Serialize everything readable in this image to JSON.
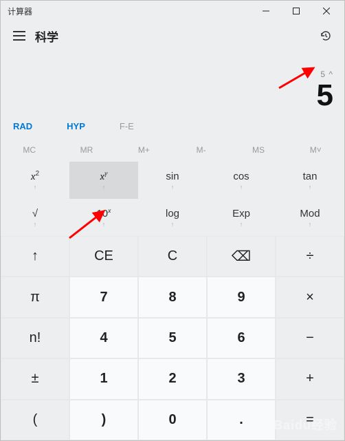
{
  "window_title": "计算器",
  "mode_title": "科学",
  "display": {
    "expr": "5 ^",
    "result": "5"
  },
  "mode_buttons": {
    "rad": "RAD",
    "hyp": "HYP",
    "fe": "F-E"
  },
  "memory": {
    "mc": "MC",
    "mr": "MR",
    "mplus": "M+",
    "mminus": "M-",
    "ms": "MS",
    "mlist": "M˅"
  },
  "func": {
    "r1": [
      {
        "main_html": "<span class='ital'>x</span><sup>2</sup>",
        "sub": "↑",
        "sel": false
      },
      {
        "main_html": "<span class='ital'>x</span><sup><span class='ital'>y</span></sup>",
        "sub": "↑",
        "sel": true
      },
      {
        "main_html": "sin",
        "sub": "↑",
        "sel": false
      },
      {
        "main_html": "cos",
        "sub": "↑",
        "sel": false
      },
      {
        "main_html": "tan",
        "sub": "↑",
        "sel": false
      }
    ],
    "r2": [
      {
        "main_html": "√",
        "sub": "↑",
        "sel": false
      },
      {
        "main_html": "10<sup><span class='ital'>x</span></sup>",
        "sub": "↑",
        "sel": false
      },
      {
        "main_html": "log",
        "sub": "↑",
        "sel": false
      },
      {
        "main_html": "Exp",
        "sub": "↑",
        "sel": false
      },
      {
        "main_html": "Mod",
        "sub": "↑",
        "sel": false
      }
    ]
  },
  "keypad": [
    [
      "↑",
      "CE",
      "C",
      "⌫",
      "÷"
    ],
    [
      "π",
      "7",
      "8",
      "9",
      "×"
    ],
    [
      "n!",
      "4",
      "5",
      "6",
      "−"
    ],
    [
      "±",
      "1",
      "2",
      "3",
      "+"
    ],
    [
      "(",
      ")",
      "0",
      ".",
      "="
    ]
  ],
  "keypad_numcols": [
    1,
    2,
    3
  ],
  "watermark": "Baidu经验"
}
